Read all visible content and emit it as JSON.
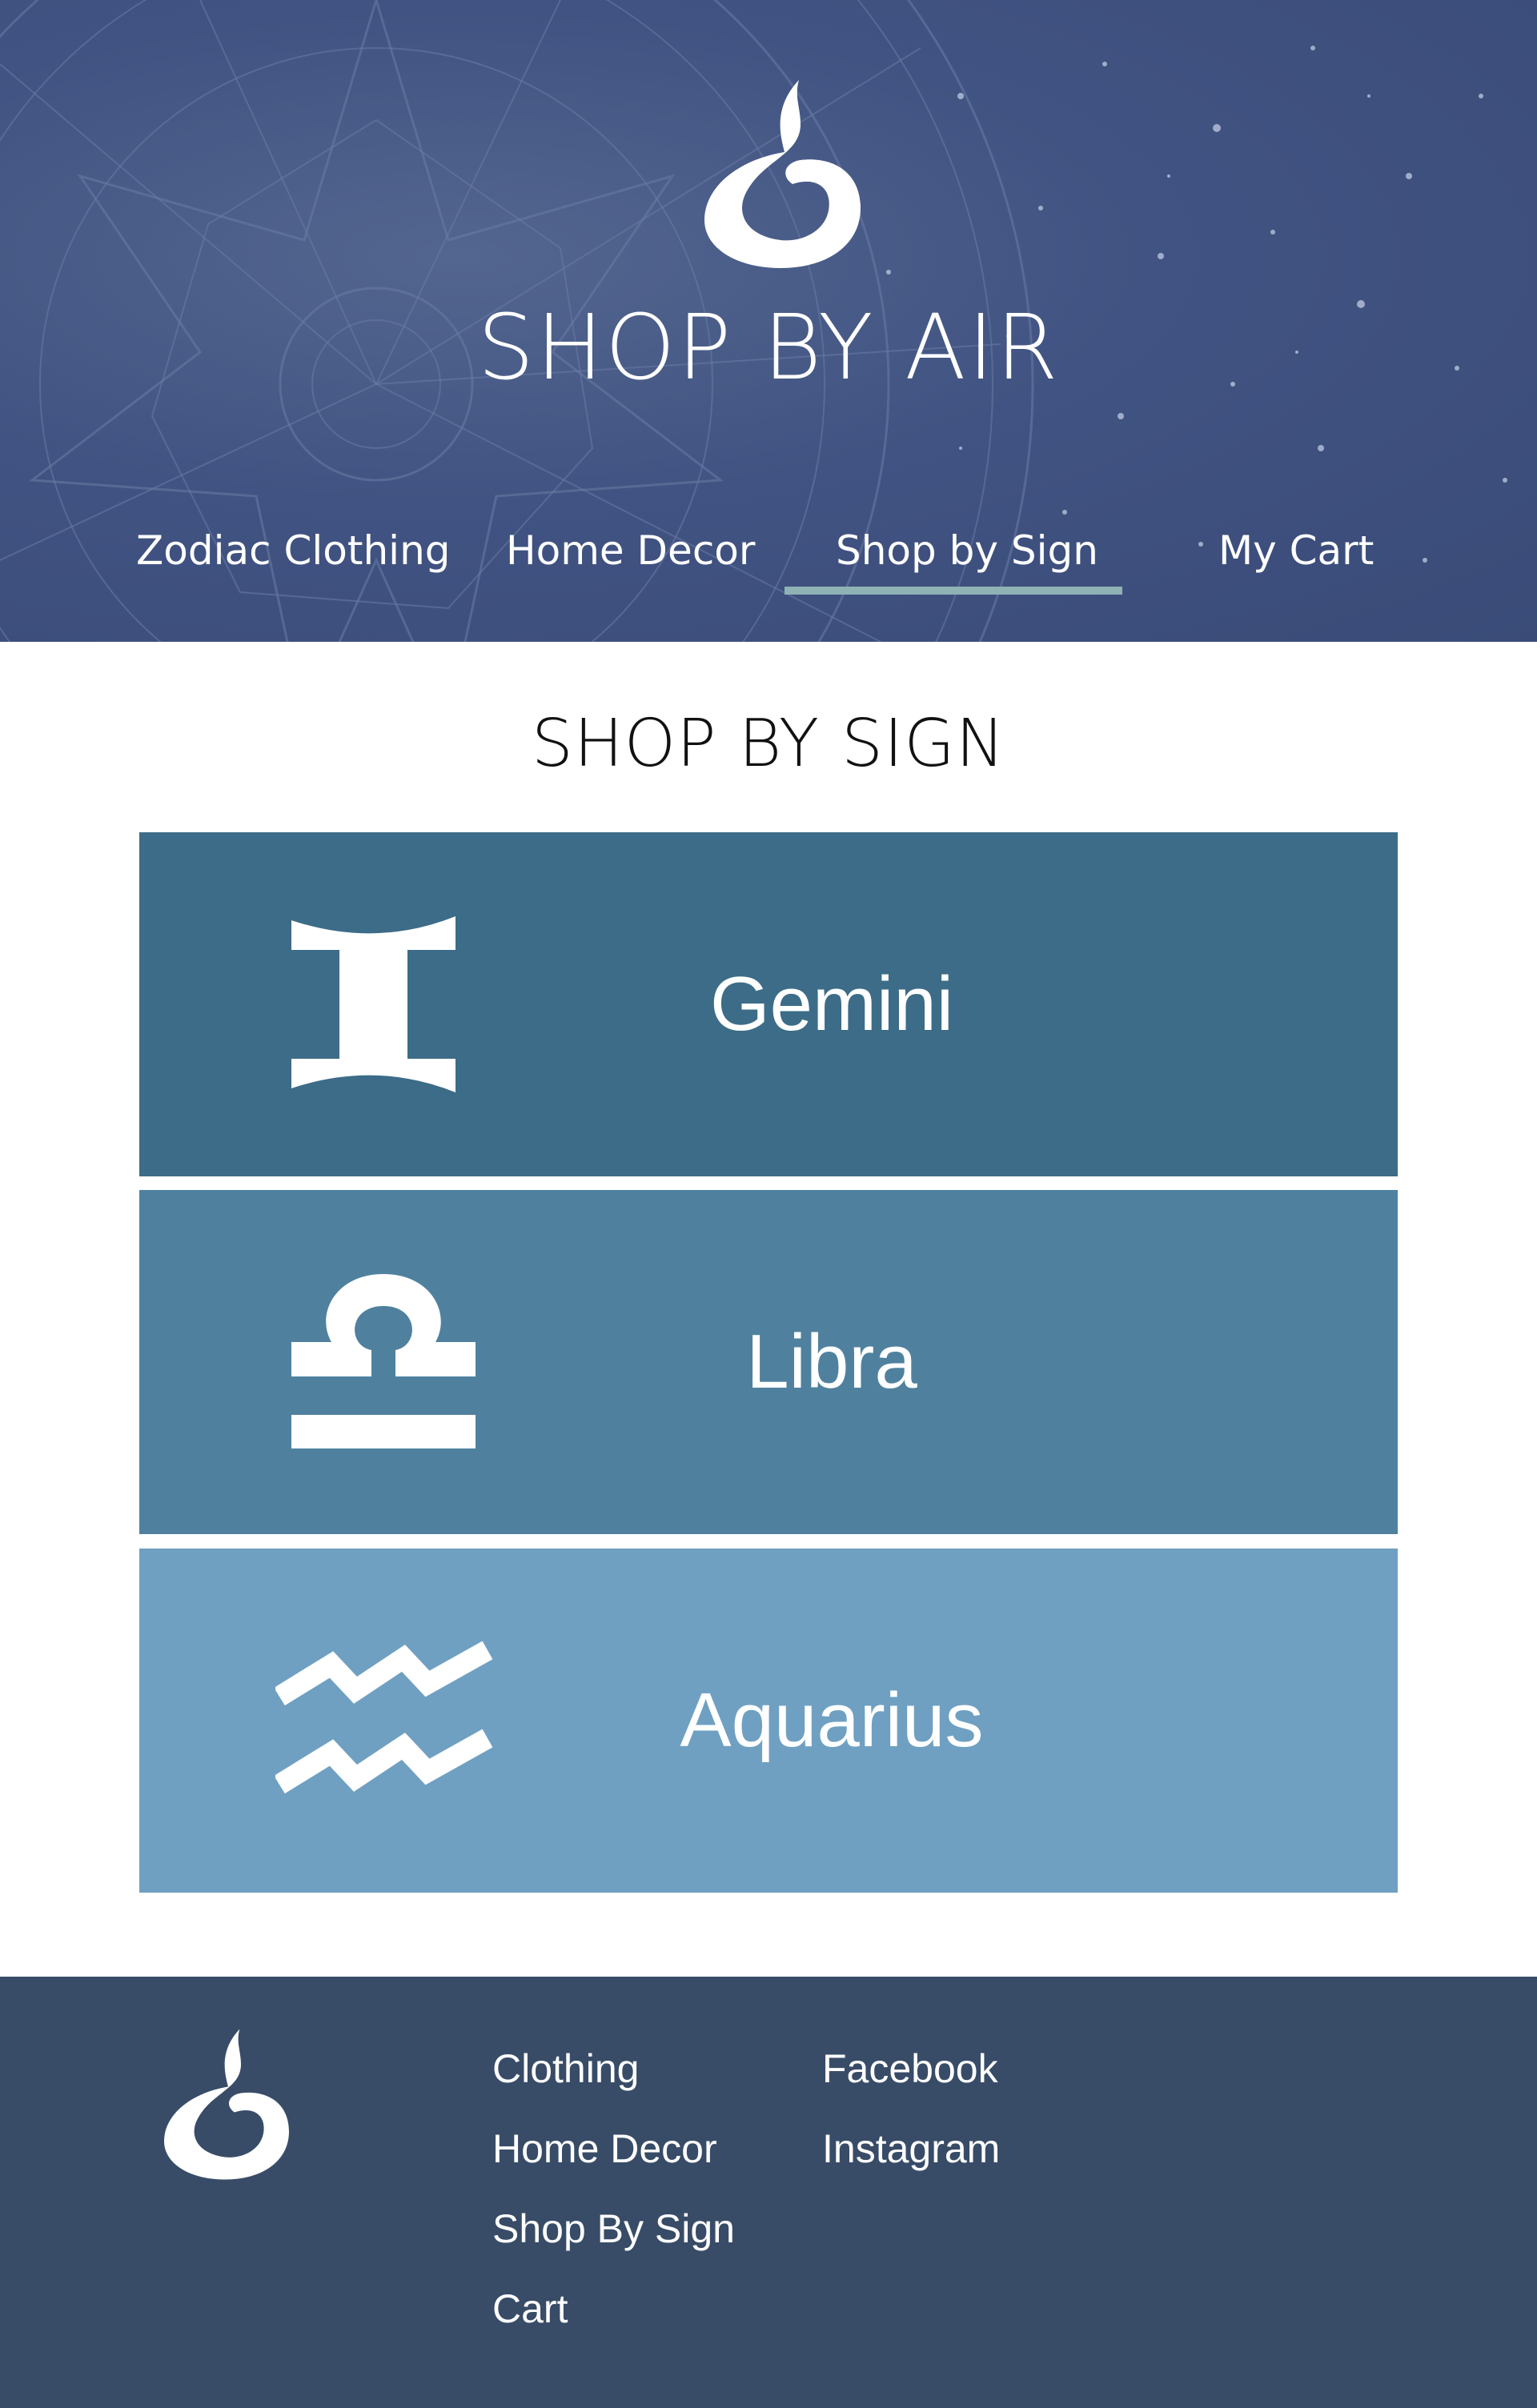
{
  "header": {
    "title": "SHOP BY AIR",
    "logo_icon": "air-flame-logo-icon",
    "nav": [
      {
        "label": "Zodiac Clothing",
        "active": false
      },
      {
        "label": "Home Decor",
        "active": false
      },
      {
        "label": "Shop by Sign",
        "active": true
      },
      {
        "label": "My Cart",
        "active": false
      }
    ],
    "active_underline_color": "#8fb2b4"
  },
  "main": {
    "title": "SHOP BY SIGN",
    "signs": [
      {
        "label": "Gemini",
        "icon": "gemini-icon",
        "color": "#3c6c88"
      },
      {
        "label": "Libra",
        "icon": "libra-icon",
        "color": "#4f819f"
      },
      {
        "label": "Aquarius",
        "icon": "aquarius-icon",
        "color": "#6fa0c2"
      }
    ]
  },
  "footer": {
    "background": "#384c68",
    "logo_icon": "air-flame-logo-icon",
    "shop_links": [
      "Clothing",
      "Home Decor",
      "Shop By Sign",
      "Cart"
    ],
    "social_links": [
      "Facebook",
      "Instagram"
    ]
  }
}
